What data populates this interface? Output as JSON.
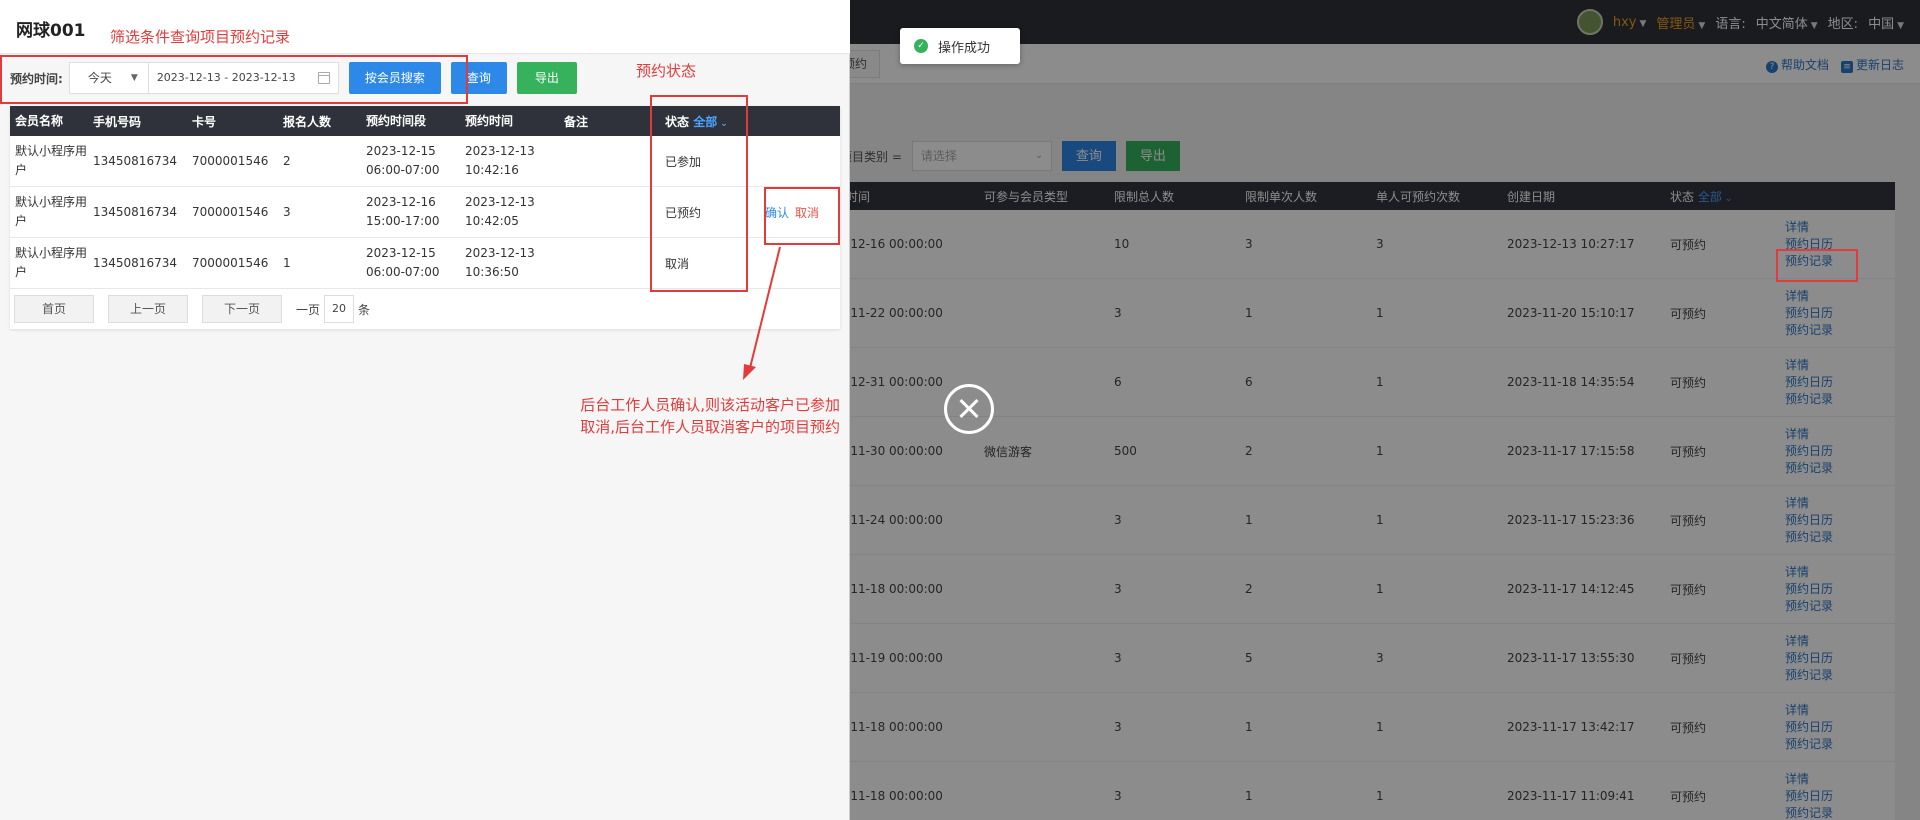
{
  "topbar": {
    "user": "hxy",
    "role": "管理员",
    "language_label": "语言:",
    "language_value": "中文简体",
    "region_label": "地区:",
    "region_value": "中国"
  },
  "tabstrip": {
    "tab": "预约",
    "help": "帮助文档",
    "changelog": "更新日志"
  },
  "bg_filter": {
    "label": "项目类别 =",
    "placeholder": "请选择",
    "query": "查询",
    "export": "导出"
  },
  "bg_table": {
    "headers": [
      "时间",
      "可参与会员类型",
      "限制总人数",
      "限制单次人数",
      "单人可预约次数",
      "创建日期",
      "状态",
      "全部"
    ],
    "rows": [
      [
        "-12-16 00:00:00",
        "",
        "10",
        "3",
        "3",
        "2023-12-13 10:27:17",
        "可预约"
      ],
      [
        "-11-22 00:00:00",
        "",
        "3",
        "1",
        "1",
        "2023-11-20 15:10:17",
        "可预约"
      ],
      [
        "-12-31 00:00:00",
        "",
        "6",
        "6",
        "1",
        "2023-11-18 14:35:54",
        "可预约"
      ],
      [
        "-11-30 00:00:00",
        "微信游客",
        "500",
        "2",
        "1",
        "2023-11-17 17:15:58",
        "可预约"
      ],
      [
        "-11-24 00:00:00",
        "",
        "3",
        "1",
        "1",
        "2023-11-17 15:23:36",
        "可预约"
      ],
      [
        "-11-18 00:00:00",
        "",
        "3",
        "2",
        "1",
        "2023-11-17 14:12:45",
        "可预约"
      ],
      [
        "-11-19 00:00:00",
        "",
        "3",
        "5",
        "3",
        "2023-11-17 13:55:30",
        "可预约"
      ],
      [
        "-11-18 00:00:00",
        "",
        "3",
        "1",
        "1",
        "2023-11-17 13:42:17",
        "可预约"
      ],
      [
        "-11-18 00:00:00",
        "",
        "3",
        "1",
        "1",
        "2023-11-17 11:09:41",
        "可预约"
      ]
    ],
    "links": [
      "详情",
      "预约日历",
      "预约记录"
    ]
  },
  "toast": "操作成功",
  "panel": {
    "title": "网球001",
    "filter_label": "预约时间:",
    "period": "今天",
    "date_range": "2023-12-13 - 2023-12-13",
    "search_member": "按会员搜索",
    "query": "查询",
    "export": "导出",
    "headers": [
      "会员名称",
      "手机号码",
      "卡号",
      "报名人数",
      "预约时间段",
      "预约时间",
      "备注",
      "状态",
      "全部"
    ],
    "rows": [
      {
        "name": "默认小程序用户",
        "phone": "13450816734",
        "card": "7000001546",
        "count": "2",
        "slot_date": "2023-12-15",
        "slot_time": "06:00-07:00",
        "book_date": "2023-12-13",
        "book_time": "10:42:16",
        "note": "",
        "status": "已参加"
      },
      {
        "name": "默认小程序用户",
        "phone": "13450816734",
        "card": "7000001546",
        "count": "3",
        "slot_date": "2023-12-16",
        "slot_time": "15:00-17:00",
        "book_date": "2023-12-13",
        "book_time": "10:42:05",
        "note": "",
        "status": "已预约"
      },
      {
        "name": "默认小程序用户",
        "phone": "13450816734",
        "card": "7000001546",
        "count": "1",
        "slot_date": "2023-12-15",
        "slot_time": "06:00-07:00",
        "book_date": "2023-12-13",
        "book_time": "10:36:50",
        "note": "",
        "status": "取消"
      }
    ],
    "ops": {
      "confirm": "确认",
      "cancel": "取消"
    },
    "pager": {
      "first": "首页",
      "prev": "上一页",
      "next": "下一页",
      "per_page": "一页",
      "size": "20",
      "unit": "条"
    }
  },
  "annotations": {
    "filter_note": "筛选条件查询项目预约记录",
    "status_note": "预约状态",
    "explain_line1": "后台工作人员确认,则该活动客户已参加",
    "explain_line2": "取消,后台工作人员取消客户的项目预约"
  }
}
